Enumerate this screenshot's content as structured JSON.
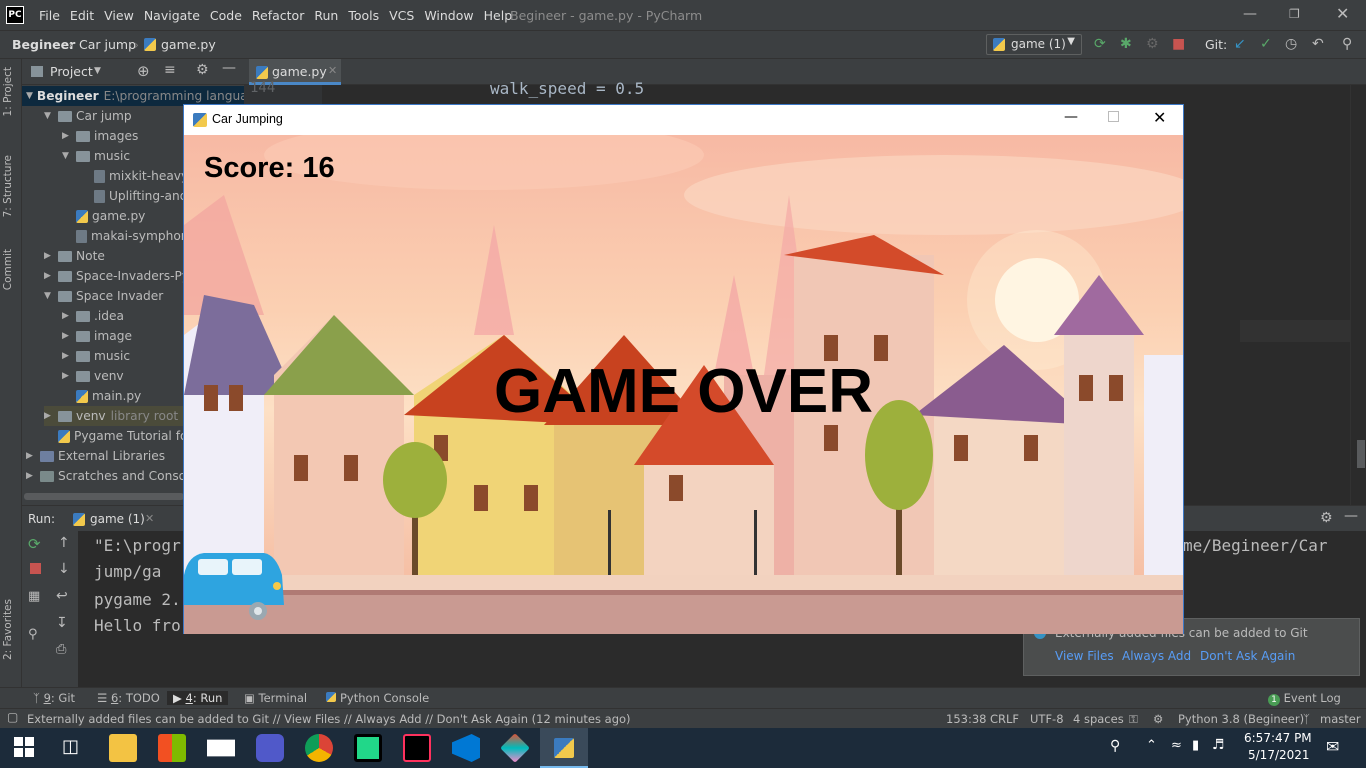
{
  "ide": {
    "logo": "PC",
    "menu": [
      "File",
      "Edit",
      "View",
      "Navigate",
      "Code",
      "Refactor",
      "Run",
      "Tools",
      "VCS",
      "Window",
      "Help"
    ],
    "title": "Begineer - game.py - PyCharm",
    "breadcrumbs": [
      "Begineer",
      "Car jump",
      "game.py"
    ],
    "run_config": "game (1)",
    "git_label": "Git:",
    "accent": "#3592c4"
  },
  "left_stripe": [
    "1: Project",
    "7: Structure",
    "Commit",
    "2: Favorites"
  ],
  "project_panel": {
    "title": "Project",
    "tree": [
      {
        "label": "Begineer",
        "suffix": "E:\\programming langua",
        "indent": 0,
        "kind": "folder",
        "open": true,
        "bold": true
      },
      {
        "label": "Car jump",
        "indent": 1,
        "kind": "folder",
        "open": true
      },
      {
        "label": "images",
        "indent": 2,
        "kind": "folder",
        "open": false
      },
      {
        "label": "music",
        "indent": 2,
        "kind": "folder",
        "open": true
      },
      {
        "label": "mixkit-heavy",
        "indent": 3,
        "kind": "mp3"
      },
      {
        "label": "Uplifting-and",
        "indent": 3,
        "kind": "mp3"
      },
      {
        "label": "game.py",
        "indent": 2,
        "kind": "py"
      },
      {
        "label": "makai-symphon",
        "indent": 2,
        "kind": "mp3"
      },
      {
        "label": "Note",
        "indent": 1,
        "kind": "folder",
        "open": false
      },
      {
        "label": "Space-Invaders-Pyg",
        "indent": 1,
        "kind": "folder",
        "open": false
      },
      {
        "label": "Space Invader",
        "indent": 1,
        "kind": "folder",
        "open": true
      },
      {
        "label": ".idea",
        "indent": 2,
        "kind": "folder",
        "open": false
      },
      {
        "label": "image",
        "indent": 2,
        "kind": "folder",
        "open": false
      },
      {
        "label": "music",
        "indent": 2,
        "kind": "folder",
        "open": false
      },
      {
        "label": "venv",
        "indent": 2,
        "kind": "folder",
        "open": false
      },
      {
        "label": "main.py",
        "indent": 2,
        "kind": "py"
      },
      {
        "label": "venv",
        "suffix": "library root",
        "indent": 1,
        "kind": "folder",
        "open": false
      },
      {
        "label": "Pygame Tutorial fo",
        "indent": 1,
        "kind": "py"
      },
      {
        "label": "External Libraries",
        "indent": 0,
        "kind": "lib",
        "open": false
      },
      {
        "label": "Scratches and Consoles",
        "indent": 0,
        "kind": "scratch",
        "open": false
      }
    ]
  },
  "editor": {
    "tab": "game.py",
    "line_number": "144",
    "code_line": "walk_speed = 0.5"
  },
  "run_panel": {
    "label": "Run:",
    "tab": "game (1)",
    "console": [
      "\"E:\\progr",
      "  jump/ga",
      "pygame 2.",
      "Hello fro"
    ],
    "console_right": "me/Begineer/Car"
  },
  "notification": {
    "message": "Externally added files can be added to Git",
    "actions": [
      "View Files",
      "Always Add",
      "Don't Ask Again"
    ]
  },
  "bottom_tabs": [
    {
      "num": "9",
      "label": ": Git"
    },
    {
      "num": "6",
      "label": ": TODO"
    },
    {
      "num": "4",
      "label": ": Run"
    },
    {
      "num": "",
      "label": "Terminal"
    },
    {
      "num": "",
      "label": "Python Console"
    }
  ],
  "event_log": {
    "count": "1",
    "label": "Event Log"
  },
  "status": {
    "message": "Externally added files can be added to Git // View Files // Always Add // Don't Ask Again (12 minutes ago)",
    "position": "153:38",
    "line_sep": "CRLF",
    "encoding": "UTF-8",
    "indent": "4 spaces",
    "interpreter": "Python 3.8 (Begineer)",
    "branch": "master"
  },
  "taskbar": {
    "time": "6:57:47 PM",
    "date": "5/17/2021"
  },
  "game": {
    "window_title": "Car Jumping",
    "score": "Score: 16",
    "message": "GAME OVER"
  }
}
